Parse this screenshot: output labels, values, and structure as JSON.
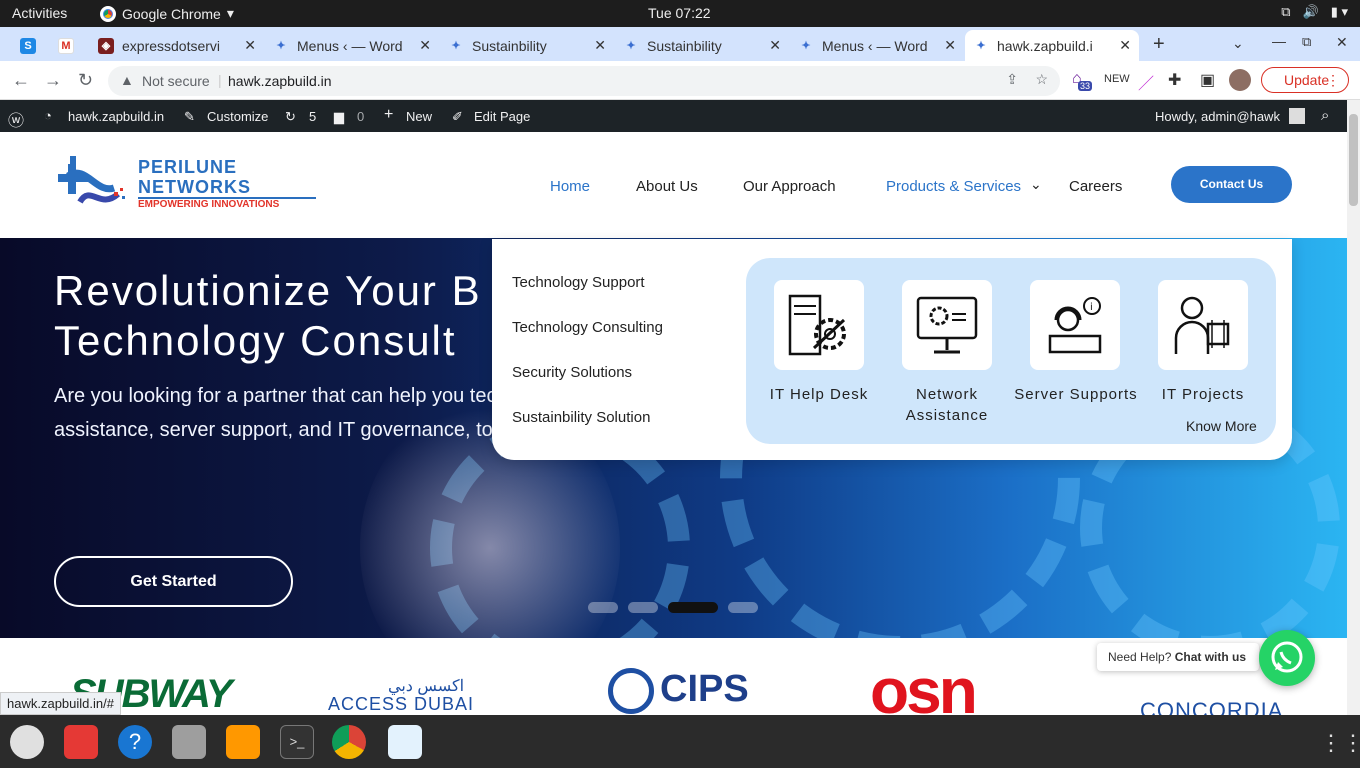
{
  "os": {
    "activities": "Activities",
    "app_name": "Google Chrome",
    "clock": "Tue 07:22"
  },
  "tabs": [
    {
      "title": "expressdotservi",
      "icon": "shield-icon"
    },
    {
      "title": "Menus ‹ — Word",
      "icon": "wp-icon"
    },
    {
      "title": "Sustainbility",
      "icon": "wp-icon"
    },
    {
      "title": "Sustainbility",
      "icon": "wp-icon"
    },
    {
      "title": "Menus ‹ — Word",
      "icon": "wp-icon"
    },
    {
      "title": "hawk.zapbuild.i",
      "icon": "wp-icon"
    }
  ],
  "pinned_tabs": [
    "skype",
    "gmail"
  ],
  "omnibox": {
    "not_secure": "Not secure",
    "url": "hawk.zapbuild.in"
  },
  "ext_badge": "33",
  "update_label": "Update",
  "wp_admin": {
    "site": "hawk.zapbuild.in",
    "customize": "Customize",
    "updates": "5",
    "comments": "0",
    "new": "New",
    "edit": "Edit Page",
    "howdy": "Howdy, admin@hawk"
  },
  "logo": {
    "line1": "PERILUNE",
    "line2": "NETWORKS",
    "tagline": "EMPOWERING INNOVATIONS"
  },
  "nav": {
    "home": "Home",
    "about": "About Us",
    "approach": "Our Approach",
    "products": "Products & Services",
    "careers": "Careers",
    "contact": "Contact Us"
  },
  "hero": {
    "line1": "Revolutionize Your B",
    "line2": "Technology Consult",
    "paragraph": "Are you looking for a partner that can help you technology? Our team of experts provides a assistance, server support, and IT governance, to help you unlock the full potential of your business.",
    "cta": "Get Started",
    "slides_total": 4,
    "active_slide": 3
  },
  "mega_menu": {
    "links": [
      "Technology Support",
      "Technology Consulting",
      "Security Solutions",
      "Sustainbility Solution"
    ],
    "cards": [
      {
        "label": "IT Help Desk",
        "icon": "helpdesk-tools-icon"
      },
      {
        "label": "Network Assistance",
        "icon": "monitor-gear-icon"
      },
      {
        "label": "Server Supports",
        "icon": "support-agent-icon"
      },
      {
        "label": "IT Projects",
        "icon": "engineer-chip-icon"
      }
    ],
    "know_more": "Know More"
  },
  "clients": {
    "logos": [
      "SUBWAY",
      "ACCESS DUBAI",
      "CIPS",
      "osn",
      "CONCORDIA"
    ],
    "arabic": "اكسس دبي"
  },
  "status_url": "hawk.zapbuild.in/#",
  "chat": {
    "prompt": "Need Help?",
    "cta": "Chat with us"
  },
  "colors": {
    "accent": "#2b74c9",
    "brand_red": "#e2342a",
    "whatsapp": "#25d366",
    "update_red": "#d93025"
  }
}
